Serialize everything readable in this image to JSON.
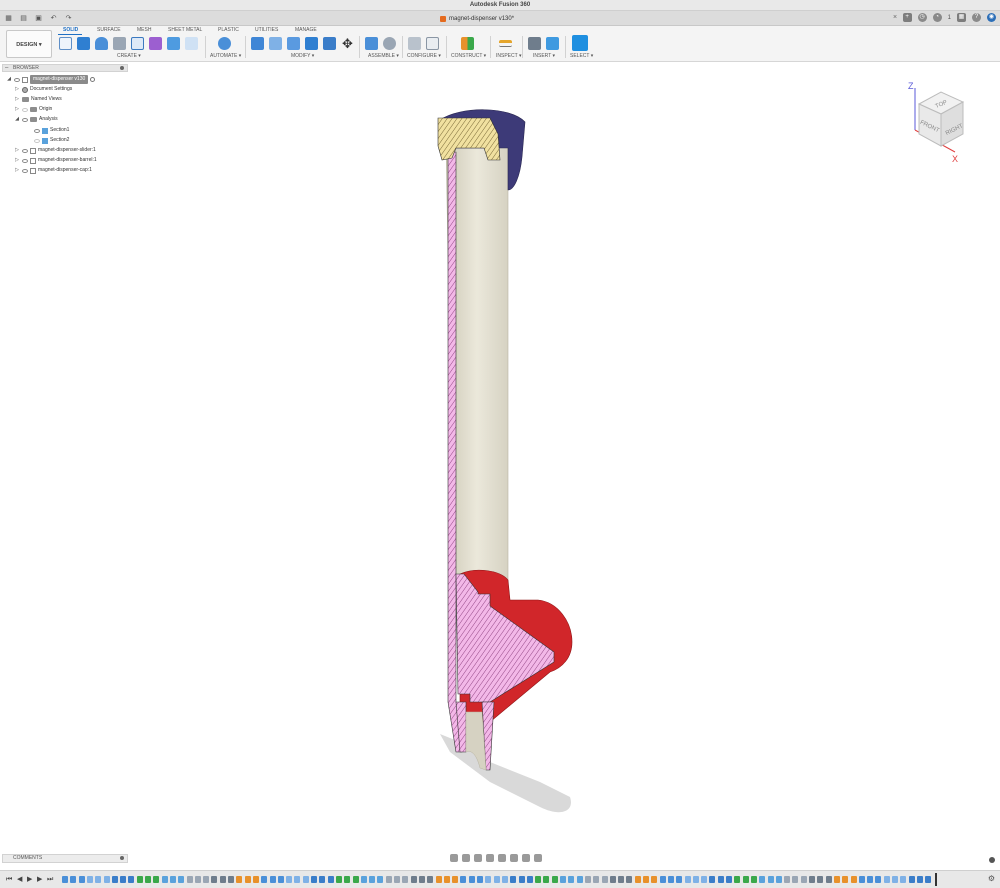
{
  "app": {
    "title": "Autodesk Fusion 360",
    "document_tab": "magnet-dispenser v130*"
  },
  "toolbar": {
    "workspace": "DESIGN ▾",
    "tabs": [
      "SOLID",
      "SURFACE",
      "MESH",
      "SHEET METAL",
      "PLASTIC",
      "UTILITIES",
      "MANAGE"
    ],
    "groups": [
      "CREATE ▾",
      "AUTOMATE ▾",
      "MODIFY ▾",
      "ASSEMBLE ▾",
      "CONFIGURE ▾",
      "CONSTRUCT ▾",
      "INSPECT ▾",
      "INSERT ▾",
      "SELECT ▾"
    ]
  },
  "header_right": {
    "notifications": "1"
  },
  "browser": {
    "title": "BROWSER",
    "root": "magnet-dispenser v130",
    "items": [
      "Document Settings",
      "Named Views",
      "Origin",
      "Analysis",
      "Section1",
      "Section2",
      "magnet-dispenser-slider:1",
      "magnet-dispenser-barrel:1",
      "magnet-dispenser-cap:1"
    ]
  },
  "comments": {
    "title": "COMMENTS"
  },
  "viewcube": {
    "top": "TOP",
    "front": "FRONT",
    "right": "RIGHT",
    "axis_z": "Z",
    "axis_x": "X"
  },
  "colors": {
    "accent": "#1e6fc4",
    "barrel": "#e3e0d2",
    "cap": "#3d3a78",
    "slider": "#d1262a",
    "section_hatch": "#f3b8e8",
    "cap_hatch": "#f1e1a0"
  }
}
